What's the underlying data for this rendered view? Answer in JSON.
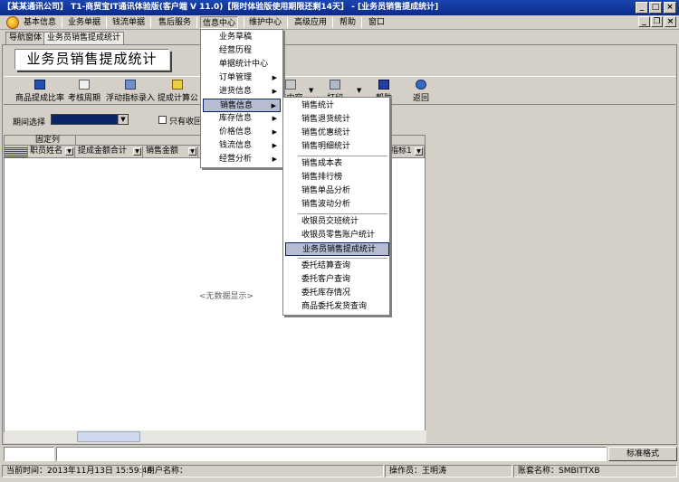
{
  "window": {
    "title": "【某某通讯公司】 T1-商贸宝IT通讯体验版(客户端 V 11.0)【限时体验版使用期限还剩14天】 - [业务员销售提成统计]",
    "controls": [
      "_",
      "□",
      "×"
    ],
    "mdi_controls": [
      "_",
      "❐",
      "×"
    ]
  },
  "menubar": [
    "基本信息",
    "业务单据",
    "钱流单据",
    "售后服务",
    "信息中心",
    "维护中心",
    "高级应用",
    "帮助",
    "窗口"
  ],
  "tabs": [
    "导航窗体",
    "业务员销售提成统计"
  ],
  "page_title": "业务员销售提成统计",
  "toolbar": {
    "items": [
      "商品提成比率",
      "考核周期",
      "浮动指标录入",
      "提成计算公式",
      "列表内容",
      "打印",
      "帮助",
      "返回"
    ],
    "partial": [
      "提成计算公",
      "表内容"
    ]
  },
  "period": {
    "label": "期间选择",
    "checkbox_label": "只有收回"
  },
  "grid": {
    "fixed_col_label": "固定列",
    "columns": [
      "职员姓名",
      "提成金额合计",
      "销售金额"
    ],
    "partial_col": "指标1",
    "empty_text": "<无数据显示>"
  },
  "format_button": "标准格式",
  "status": {
    "time_label": "当前时间：",
    "time_value": "2013年11月13日  15:59:46",
    "user_label": "用户名称：",
    "user_value": "",
    "operator_label": "操作员：",
    "operator_value": "王明涛",
    "account_label": "账套名称：",
    "account_value": "SMBITTXB"
  },
  "info_center_menu": [
    {
      "label": "业务草稿",
      "has_sub": false
    },
    {
      "label": "经营历程",
      "has_sub": false
    },
    {
      "label": "单据统计中心",
      "has_sub": false
    },
    {
      "label": "订单管理",
      "has_sub": true
    },
    {
      "label": "进货信息",
      "has_sub": true
    },
    {
      "label": "销售信息",
      "has_sub": true
    },
    {
      "label": "库存信息",
      "has_sub": true
    },
    {
      "label": "价格信息",
      "has_sub": true
    },
    {
      "label": "钱流信息",
      "has_sub": true
    },
    {
      "label": "经营分析",
      "has_sub": true
    }
  ],
  "sales_info_menu": [
    "销售统计",
    "销售退货统计",
    "销售优惠统计",
    "销售明细统计",
    "销售成本表",
    "销售排行榜",
    "销售单品分析",
    "销售波动分析",
    "收银员交班统计",
    "收银员零售账户统计",
    "业务员销售提成统计",
    "委托结算查询",
    "委托客户查询",
    "委托库存情况",
    "商品委托发货查询"
  ],
  "colors": {
    "title_bar": "#0b2a8a",
    "highlight": "#b6bdd2",
    "selection": "#0a246a"
  }
}
